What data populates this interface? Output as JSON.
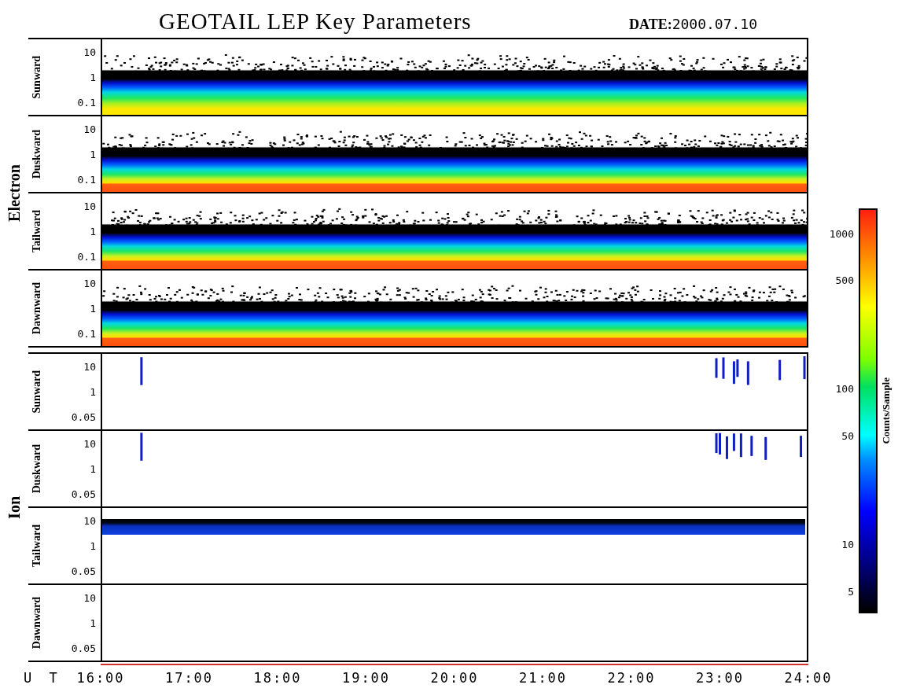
{
  "title": "GEOTAIL LEP Key Parameters",
  "date": {
    "label": "DATE:",
    "value": "2000.07.10"
  },
  "groups": [
    {
      "name": "Electron",
      "panels": [
        {
          "direction": "Sunward",
          "kind": "spectrum",
          "yticks": [
            "10",
            "1",
            "0.1"
          ]
        },
        {
          "direction": "Duskward",
          "kind": "spectrum",
          "yticks": [
            "10",
            "1",
            "0.1"
          ]
        },
        {
          "direction": "Tailward",
          "kind": "spectrum",
          "yticks": [
            "10",
            "1",
            "0.1"
          ]
        },
        {
          "direction": "Dawnward",
          "kind": "spectrum",
          "yticks": [
            "10",
            "1",
            "0.1"
          ]
        }
      ]
    },
    {
      "name": "Ion",
      "panels": [
        {
          "direction": "Sunward",
          "kind": "bursts",
          "yticks": [
            "10",
            "1",
            "0.05"
          ]
        },
        {
          "direction": "Duskward",
          "kind": "bursts",
          "yticks": [
            "10",
            "1",
            "0.05"
          ]
        },
        {
          "direction": "Tailward",
          "kind": "band",
          "yticks": [
            "10",
            "1",
            "0.05"
          ]
        },
        {
          "direction": "Dawnward",
          "kind": "empty",
          "yticks": [
            "10",
            "1",
            "0.05"
          ]
        }
      ]
    }
  ],
  "time_axis": {
    "label": "U T",
    "ticks": [
      "16:00",
      "17:00",
      "18:00",
      "19:00",
      "20:00",
      "21:00",
      "22:00",
      "23:00",
      "24:00"
    ]
  },
  "colorbar": {
    "title": "Counts/Sample",
    "ticks": [
      "1000",
      "500",
      "100",
      "50",
      "10",
      "5"
    ]
  }
}
